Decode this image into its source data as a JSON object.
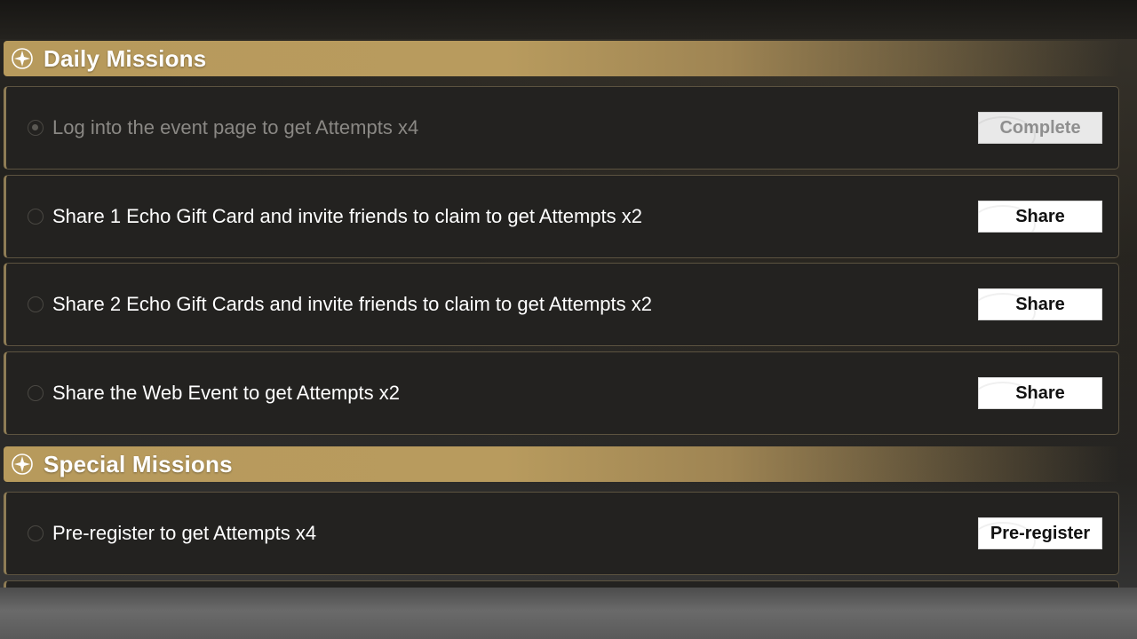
{
  "sections": [
    {
      "title": "Daily Missions",
      "missions": [
        {
          "label": "Log into the event page to get Attempts x4",
          "button": "Complete",
          "completed": true
        },
        {
          "label": "Share 1 Echo Gift Card and invite friends to claim to get Attempts x2",
          "button": "Share",
          "completed": false
        },
        {
          "label": "Share 2 Echo Gift Cards and invite friends to claim to get Attempts x2",
          "button": "Share",
          "completed": false
        },
        {
          "label": "Share the Web Event to get Attempts x2",
          "button": "Share",
          "completed": false
        }
      ]
    },
    {
      "title": "Special Missions",
      "missions": [
        {
          "label": "Pre-register to get Attempts x4",
          "button": "Pre-register",
          "completed": false
        }
      ]
    }
  ],
  "colors": {
    "accent_gold": "#b79a5c",
    "row_bg": "#232220",
    "row_border": "#5c5340"
  },
  "icons": {
    "section_icon": "four-point-star-icon",
    "mission_status": "radio-circle-icon"
  }
}
